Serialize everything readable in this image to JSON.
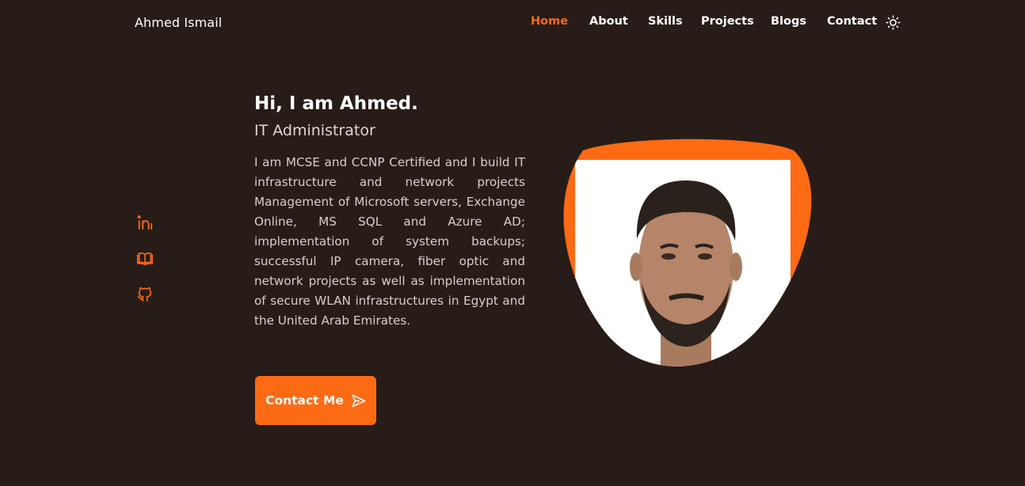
{
  "header": {
    "brand": "Ahmed Ismail",
    "nav": [
      {
        "label": "Home",
        "active": true
      },
      {
        "label": "About",
        "active": false
      },
      {
        "label": "Skills",
        "active": false
      },
      {
        "label": "Projects",
        "active": false
      },
      {
        "label": "Blogs",
        "active": false
      },
      {
        "label": "Contact",
        "active": false
      }
    ],
    "theme_toggle_icon": "sun-icon"
  },
  "social": [
    {
      "icon": "linkedin-icon"
    },
    {
      "icon": "book-icon"
    },
    {
      "icon": "github-icon"
    }
  ],
  "hero": {
    "title": "Hi, I am Ahmed.",
    "subtitle": "IT Administrator",
    "description": "I am MCSE and CCNP Certified and I build IT infrastructure and network projects Management of Microsoft servers, Exchange Online, MS SQL and Azure AD; implementation of system backups; successful IP camera, fiber optic and network projects as well as implementation of secure WLAN infrastructures in Egypt and the United Arab Emirates.",
    "cta_label": "Contact Me",
    "cta_icon": "send-icon",
    "photo": "profile-photo"
  },
  "colors": {
    "background": "#271c18",
    "accent": "#fd6a14",
    "text": "#ffffff",
    "muted_text": "#d9cfc9"
  }
}
